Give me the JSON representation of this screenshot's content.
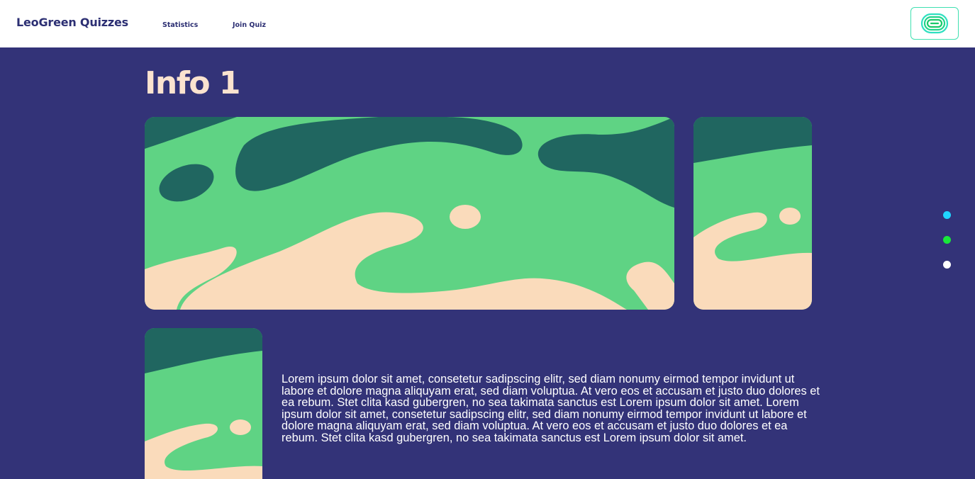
{
  "header": {
    "brand": "LeoGreen Quizzes",
    "nav": [
      "Statistics",
      "Join Quiz"
    ],
    "logo_icon": "leogreen-logo-icon"
  },
  "main": {
    "title": "Info 1",
    "paragraph": "Lorem ipsum dolor sit amet, consetetur sadipscing elitr, sed diam nonumy eirmod tempor invidunt ut labore et dolore magna aliquyam erat, sed diam voluptua. At vero eos et accusam et justo duo dolores et ea rebum. Stet clita kasd gubergren, no sea takimata sanctus est Lorem ipsum dolor sit amet. Lorem ipsum dolor sit amet, consetetur sadipscing elitr, sed diam nonumy eirmod tempor invidunt ut labore et dolore magna aliquyam erat, sed diam voluptua. At vero eos et accusam et justo duo dolores et ea rebum. Stet clita kasd gubergren, no sea takimata sanctus est Lorem ipsum dolor sit amet."
  },
  "slide_dots": [
    {
      "color": "#1fd6ff"
    },
    {
      "color": "#19e83a"
    },
    {
      "color": "#ffffff"
    }
  ],
  "colors": {
    "background": "#333378",
    "brand_text": "#2c2f73",
    "title_text": "#fbe3cf",
    "illustration_green": "#5fd384",
    "illustration_dark": "#206660",
    "illustration_peach": "#fadbbb"
  }
}
